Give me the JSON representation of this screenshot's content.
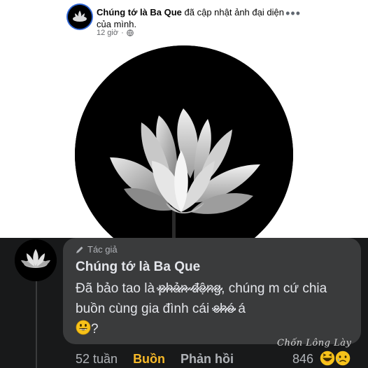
{
  "post": {
    "author": "Chúng tớ là Ba Que",
    "action": " đã cập nhật ảnh đại diện của mình.",
    "time": "12 giờ",
    "more_icon": "more-horizontal-icon",
    "globe_icon": "globe-icon",
    "image": "white-lotus-on-black"
  },
  "comment": {
    "badge": "Tác giả",
    "author": "Chúng tớ là Ba Que",
    "text_part1": "Đã bảo tao là ",
    "struck_word1": "phản động",
    "text_part2": ", chúng m cứ chia buồn cùng gia đình cái ",
    "struck_word2": "chó",
    "text_part3": " á",
    "text_part4": "?",
    "time": "52 tuần",
    "react_label": "Buồn",
    "reply_label": "Phản hồi",
    "reaction_count": "846",
    "reaction_icons": [
      "haha-icon",
      "sad-icon"
    ]
  },
  "watermark": "Chốn Lông Lày",
  "colors": {
    "accent_sad": "#f7b928",
    "dark_bg": "#18191a",
    "bubble_bg": "#3a3b3c",
    "text_light": "#e4e6eb"
  }
}
